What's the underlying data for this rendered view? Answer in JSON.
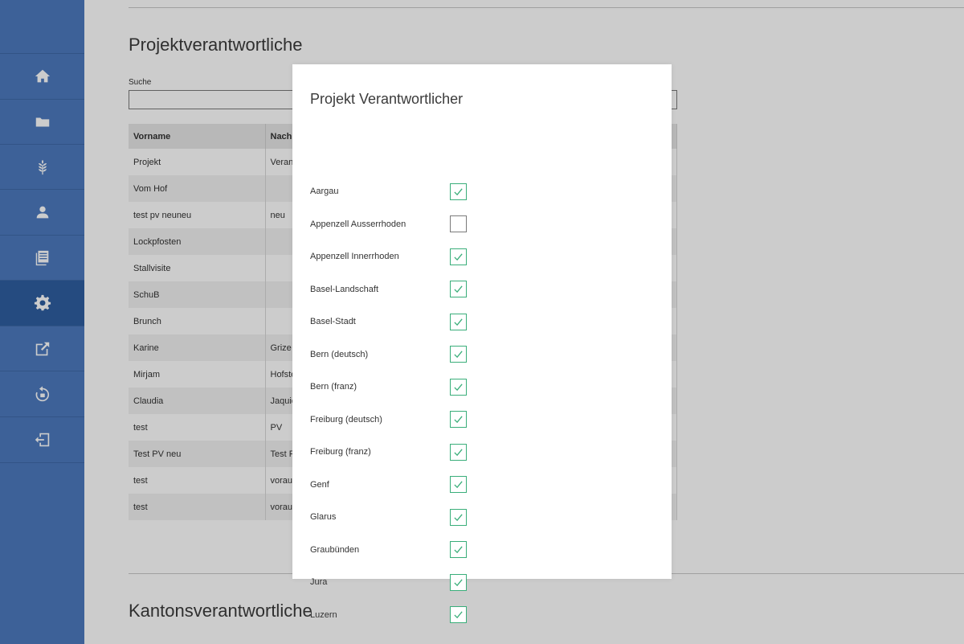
{
  "sidebar": {
    "items": [
      {
        "icon": "home-icon",
        "active": false
      },
      {
        "icon": "folder-icon",
        "active": false
      },
      {
        "icon": "wheat-icon",
        "active": false
      },
      {
        "icon": "user-icon",
        "active": false
      },
      {
        "icon": "documents-icon",
        "active": false
      },
      {
        "icon": "gear-icon",
        "active": true
      },
      {
        "icon": "external-link-icon",
        "active": false
      },
      {
        "icon": "restore-icon",
        "active": false
      },
      {
        "icon": "logout-icon",
        "active": false
      }
    ]
  },
  "main": {
    "section_title": "Projektverantwortliche",
    "search": {
      "label": "Suche",
      "value": ""
    },
    "table": {
      "headers": [
        "Vorname",
        "Nachname"
      ],
      "rows": [
        [
          "Projekt",
          "Verantwortlicher"
        ],
        [
          "Vom Hof",
          ""
        ],
        [
          "test pv neuneu",
          "neu"
        ],
        [
          "Lockpfosten",
          ""
        ],
        [
          "Stallvisite",
          ""
        ],
        [
          "SchuB",
          ""
        ],
        [
          "Brunch",
          ""
        ],
        [
          "Karine",
          "Grize"
        ],
        [
          "Mirjam",
          "Hofstetter"
        ],
        [
          "Claudia",
          "Jaquier"
        ],
        [
          "test",
          "PV"
        ],
        [
          "Test PV neu",
          "Test PV"
        ],
        [
          "test",
          "voraus"
        ],
        [
          "test",
          "voraus"
        ]
      ]
    },
    "section2_title": "Kantonsverantwortliche"
  },
  "modal": {
    "title": "Projekt Verantwortlicher",
    "accent_color": "#3aae7a",
    "cantons": [
      {
        "label": "Aargau",
        "checked": true
      },
      {
        "label": "Appenzell Ausserrhoden",
        "checked": false
      },
      {
        "label": "Appenzell Innerrhoden",
        "checked": true
      },
      {
        "label": "Basel-Landschaft",
        "checked": true
      },
      {
        "label": "Basel-Stadt",
        "checked": true
      },
      {
        "label": "Bern (deutsch)",
        "checked": true
      },
      {
        "label": "Bern (franz)",
        "checked": true
      },
      {
        "label": "Freiburg (deutsch)",
        "checked": true
      },
      {
        "label": "Freiburg (franz)",
        "checked": true
      },
      {
        "label": "Genf",
        "checked": true
      },
      {
        "label": "Glarus",
        "checked": true
      },
      {
        "label": "Graubünden",
        "checked": true
      },
      {
        "label": "Jura",
        "checked": true
      },
      {
        "label": "Luzern",
        "checked": true
      }
    ]
  }
}
